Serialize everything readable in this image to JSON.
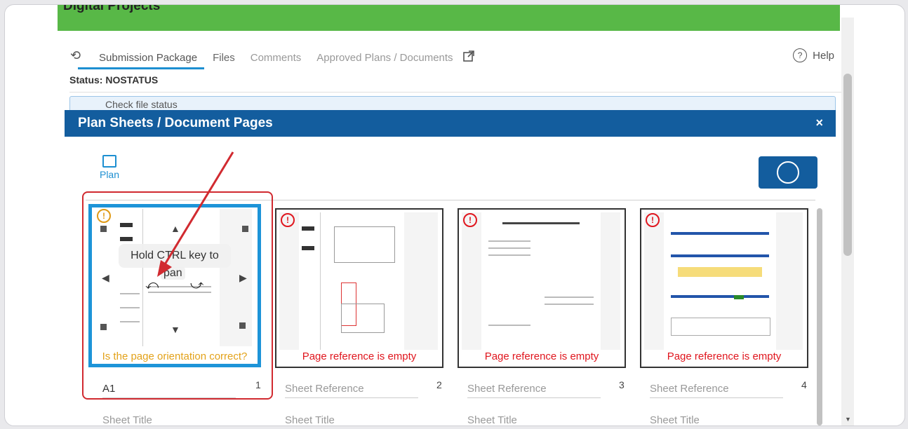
{
  "app": {
    "banner_title": "Digital Projects"
  },
  "tabs": [
    {
      "label": "Submission Package"
    },
    {
      "label": "Files"
    },
    {
      "label": "Comments"
    },
    {
      "label": "Approved Plans / Documents"
    }
  ],
  "help_label": "Help",
  "status_text": "Status: NOSTATUS",
  "info_text": "Check file status",
  "modal": {
    "title": "Plan Sheets / Document Pages",
    "close_label": "×",
    "plan_label": "Plan"
  },
  "cards": [
    {
      "page": "1",
      "message": "Is the page orientation correct?",
      "reference": "A1",
      "title_placeholder": "Sheet Title",
      "warn": "orange"
    },
    {
      "page": "2",
      "message": "Page reference is empty",
      "reference_placeholder": "Sheet Reference",
      "title_placeholder": "Sheet Title",
      "warn": "red"
    },
    {
      "page": "3",
      "message": "Page reference is empty",
      "reference_placeholder": "Sheet Reference",
      "title_placeholder": "Sheet Title",
      "warn": "red"
    },
    {
      "page": "4",
      "message": "Page reference is empty",
      "reference_placeholder": "Sheet Reference",
      "title_placeholder": "Sheet Title",
      "warn": "red"
    }
  ],
  "overlay": {
    "hint_line1": "Hold CTRL key to",
    "hint_line2": "pan"
  },
  "colors": {
    "banner": "#58b847",
    "modal_header": "#135d9e",
    "selected_border": "#1d94d8",
    "annotation_red": "#d12a30",
    "warning_red": "#e0161e",
    "warning_orange": "#e3a21a"
  }
}
